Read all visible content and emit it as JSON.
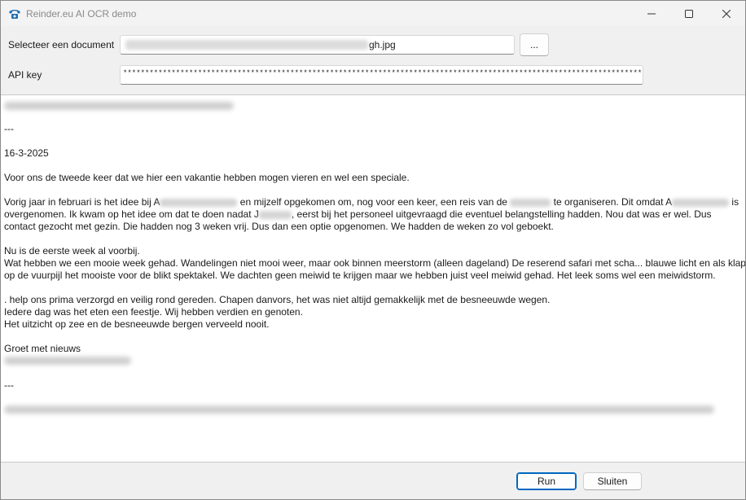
{
  "window": {
    "title": "Reinder.eu AI OCR demo",
    "icon": "telephone-icon",
    "accent_color": "#0067c0"
  },
  "form": {
    "document_label": "Selecteer een document",
    "document_value_suffix": "gh.jpg",
    "browse_label": "...",
    "api_key_label": "API key",
    "api_key_value": "************************************************************************************************************************************************************************************************************"
  },
  "ocr": {
    "lines": [
      {
        "text": "---"
      },
      {
        "text": "16-3-2025"
      },
      {
        "text": "Voor ons de tweede keer dat we hier een vakantie hebben mogen vieren en wel een speciale."
      },
      {
        "a": "Vorig jaar in februari is het idee bij A",
        "b": " en mijzelf opgekomen om, nog voor een keer, een reis van de ",
        "c": " te organiseren. Dit omdat A",
        "d": " is"
      },
      {
        "a": "overgenomen. Ik kwam op het idee om dat te doen nadat J",
        "b": ", eerst bij het personeel uitgevraagd die eventuel belangstelling hadden. Nou dat was er wel. Dus"
      },
      {
        "text": "contact gezocht met gezin. Die hadden nog 3 weken vrij. Dus dan een optie opgenomen. We hadden de weken zo vol geboekt."
      },
      {
        "text": "Nu is de eerste week al voorbij."
      },
      {
        "text": "Wat hebben we een mooie week gehad. Wandelingen niet mooi weer, maar ook binnen meerstorm (alleen dageland) De reserend safari met scha... blauwe licht en als klap"
      },
      {
        "text": "op de vuurpijl het mooiste voor de blikt spektakel. We dachten geen meiwid te krijgen maar we hebben juist veel meiwid gehad. Het leek soms wel een meiwidstorm."
      },
      {
        "text": ". help ons prima verzorgd en veilig rond gereden. Chapen danvors, het was niet altijd gemakkelijk met de besneeuwde wegen."
      },
      {
        "text": "Iedere dag was het eten een feestje. Wij hebben verdien en genoten."
      },
      {
        "text": "Het uitzicht op zee en de besneeuwde bergen verveeld nooit."
      },
      {
        "text": "Groet met nieuws"
      },
      {
        "text": "---"
      }
    ]
  },
  "footer": {
    "run_label": "Run",
    "close_label": "Sluiten"
  }
}
